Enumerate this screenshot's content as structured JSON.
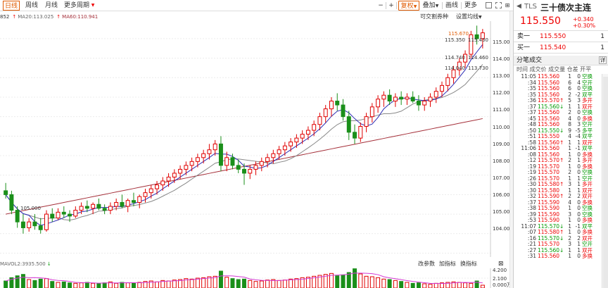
{
  "toolbar": {
    "periods": [
      "日线",
      "周线",
      "月线",
      "更多周期"
    ],
    "active_period": "日线",
    "more_marker": "▼",
    "minus": "−",
    "plus": "+",
    "fuquan": "复权",
    "overlay": "叠加",
    "draw": "画线",
    "more": "更多"
  },
  "legend": {
    "tail": "852",
    "ma20": "MA20:113.025",
    "ma20_arrow": "↑",
    "ma60": "MA60:110.941",
    "ma60_arrow": "↑"
  },
  "chart_tools": {
    "convert_arb": "可交割券种",
    "set_ma": "设置均线"
  },
  "volume_legend": {
    "label": "MAVOL2:3935.500",
    "arrow": "↓",
    "change_params": "改参数",
    "add_indicator": "加指标",
    "switch_indicator": "换指标"
  },
  "price_annotations": {
    "high": "115.670",
    "a": "115.350",
    "b": "115.430",
    "c": "114.740",
    "d": "114.460",
    "e": "114.040",
    "f": "113.730",
    "low": "105.000"
  },
  "price_axis": [
    "115.000",
    "114.000",
    "113.000",
    "112.000",
    "111.000",
    "110.000",
    "109.000",
    "108.000",
    "107.000",
    "106.000",
    "105.000",
    "104.000"
  ],
  "volume_axis": [
    "4.200",
    "2.100",
    "0.000"
  ],
  "volume_unit": "万",
  "instrument": {
    "arrow": "◀",
    "code": "TLS",
    "name": "三十债次主连",
    "price": "115.550",
    "change": "+0.340",
    "change_pct": "+0.30%"
  },
  "orderbook": {
    "sell_label": "卖一",
    "sell_price": "115.550",
    "sell_vol": "1",
    "buy_label": "买一",
    "buy_price": "115.540",
    "buy_vol": "1"
  },
  "fenbi": {
    "title": "分笔成交",
    "detail": "详",
    "headers": "时间    成交价 成交量 仓差 开平"
  },
  "trades": [
    {
      "t": "11:05",
      "p": "115.560",
      "a": "",
      "v": "1",
      "d": "0",
      "tp": "空换",
      "c": "#090"
    },
    {
      "t": ":34",
      "p": "115.560",
      "a": "",
      "v": "6",
      "d": "4",
      "tp": "空开",
      "c": "#090"
    },
    {
      "t": ":35",
      "p": "115.560",
      "a": "",
      "v": "6",
      "d": "0",
      "tp": "空换",
      "c": "#090"
    },
    {
      "t": ":35",
      "p": "115.560",
      "a": "",
      "v": "2",
      "d": "-2",
      "tp": "双平",
      "c": "#090"
    },
    {
      "t": ":36",
      "p": "115.570",
      "a": "↑",
      "v": "5",
      "d": "3",
      "tp": "多开",
      "c": "#e00"
    },
    {
      "t": ":37",
      "p": "115.560",
      "a": "↓",
      "v": "1",
      "d": "1",
      "tp": "双开",
      "c": "#e00"
    },
    {
      "t": ":37",
      "p": "115.560",
      "a": "",
      "v": "2",
      "d": "0",
      "tp": "空换",
      "c": "#090"
    },
    {
      "t": ":45",
      "p": "115.560",
      "a": "",
      "v": "4",
      "d": "0",
      "tp": "多换",
      "c": "#e00"
    },
    {
      "t": ":48",
      "p": "115.560",
      "a": "",
      "v": "8",
      "d": "3",
      "tp": "空开",
      "c": "#090"
    },
    {
      "t": ":50",
      "p": "115.550",
      "a": "↓",
      "v": "9",
      "d": "-5",
      "tp": "多平",
      "c": "#090"
    },
    {
      "t": ":51",
      "p": "115.550",
      "a": "",
      "v": "4",
      "d": "-4",
      "tp": "双平",
      "c": "#090"
    },
    {
      "t": ":58",
      "p": "115.560",
      "a": "↑",
      "v": "1",
      "d": "1",
      "tp": "双开",
      "c": "#e00"
    },
    {
      "t": "11:06",
      "p": "115.560",
      "a": "",
      "v": "1",
      "d": "-1",
      "tp": "双平",
      "c": "#090"
    },
    {
      "t": ":08",
      "p": "115.560",
      "a": "",
      "v": "1",
      "d": "0",
      "tp": "多换",
      "c": "#e00"
    },
    {
      "t": ":12",
      "p": "115.570",
      "a": "↑",
      "v": "2",
      "d": "1",
      "tp": "多开",
      "c": "#e00"
    },
    {
      "t": ":19",
      "p": "115.570",
      "a": "",
      "v": "1",
      "d": "0",
      "tp": "多换",
      "c": "#e00"
    },
    {
      "t": ":19",
      "p": "115.570",
      "a": "",
      "v": "2",
      "d": "0",
      "tp": "空换",
      "c": "#090"
    },
    {
      "t": ":26",
      "p": "115.570",
      "a": "",
      "v": "1",
      "d": "1",
      "tp": "空开",
      "c": "#090"
    },
    {
      "t": ":30",
      "p": "115.580",
      "a": "↑",
      "v": "3",
      "d": "1",
      "tp": "多开",
      "c": "#e00"
    },
    {
      "t": ":30",
      "p": "115.580",
      "a": "",
      "v": "1",
      "d": "1",
      "tp": "双开",
      "c": "#e00"
    },
    {
      "t": ":32",
      "p": "115.590",
      "a": "↑",
      "v": "2",
      "d": "2",
      "tp": "双开",
      "c": "#e00"
    },
    {
      "t": ":37",
      "p": "115.590",
      "a": "",
      "v": "4",
      "d": "0",
      "tp": "多换",
      "c": "#e00"
    },
    {
      "t": ":38",
      "p": "115.590",
      "a": "",
      "v": "1",
      "d": "0",
      "tp": "空换",
      "c": "#090"
    },
    {
      "t": ":39",
      "p": "115.590",
      "a": "",
      "v": "3",
      "d": "0",
      "tp": "空换",
      "c": "#090"
    },
    {
      "t": ":53",
      "p": "115.590",
      "a": "",
      "v": "1",
      "d": "0",
      "tp": "多换",
      "c": "#e00"
    },
    {
      "t": "11:07",
      "p": "115.570",
      "a": "↓",
      "v": "1",
      "d": "-1",
      "tp": "双平",
      "c": "#090"
    },
    {
      "t": ":07",
      "p": "115.580",
      "a": "↑",
      "v": "1",
      "d": "0",
      "tp": "多换",
      "c": "#e00"
    },
    {
      "t": ":16",
      "p": "115.570",
      "a": "↓",
      "v": "2",
      "d": "2",
      "tp": "双开",
      "c": "#e00"
    },
    {
      "t": ":21",
      "p": "115.570",
      "a": "",
      "v": "3",
      "d": "1",
      "tp": "空开",
      "c": "#090"
    },
    {
      "t": ":27",
      "p": "115.560",
      "a": "↓",
      "v": "1",
      "d": "1",
      "tp": "双开",
      "c": "#e00"
    },
    {
      "t": ":31",
      "p": "115.560",
      "a": "",
      "v": "1",
      "d": "0",
      "tp": "多换",
      "c": "#e00"
    }
  ],
  "colors": {
    "up": "#e00000",
    "down": "#1a8f1a",
    "ma5": "#2d2db4",
    "ma10": "#888888",
    "ma60": "#a5303a",
    "vol_ma": "#d43ad4",
    "accent": "#e05a00"
  },
  "chart_data": {
    "type": "candlestick",
    "price_range": [
      103.8,
      115.9
    ],
    "volume_range": [
      0,
      4.2
    ],
    "candles": [
      {
        "o": 107.2,
        "h": 107.6,
        "l": 106.8,
        "c": 107.0,
        "v": 1.5
      },
      {
        "o": 107.0,
        "h": 107.2,
        "l": 106.0,
        "c": 106.2,
        "v": 2.2
      },
      {
        "o": 106.2,
        "h": 106.4,
        "l": 105.3,
        "c": 105.6,
        "v": 2.6
      },
      {
        "o": 105.6,
        "h": 106.0,
        "l": 105.0,
        "c": 105.3,
        "v": 2.9
      },
      {
        "o": 105.3,
        "h": 105.8,
        "l": 105.1,
        "c": 105.6,
        "v": 1.8
      },
      {
        "o": 105.6,
        "h": 106.0,
        "l": 105.2,
        "c": 105.4,
        "v": 1.6
      },
      {
        "o": 105.4,
        "h": 105.8,
        "l": 105.0,
        "c": 105.2,
        "v": 1.9
      },
      {
        "o": 105.2,
        "h": 106.2,
        "l": 105.1,
        "c": 106.0,
        "v": 2.0
      },
      {
        "o": 106.0,
        "h": 106.3,
        "l": 105.6,
        "c": 105.8,
        "v": 1.4
      },
      {
        "o": 105.8,
        "h": 106.3,
        "l": 105.7,
        "c": 106.1,
        "v": 1.2
      },
      {
        "o": 106.1,
        "h": 106.4,
        "l": 105.8,
        "c": 106.0,
        "v": 1.3
      },
      {
        "o": 106.0,
        "h": 106.2,
        "l": 105.6,
        "c": 105.9,
        "v": 1.1
      },
      {
        "o": 105.9,
        "h": 106.4,
        "l": 105.8,
        "c": 106.2,
        "v": 1.0
      },
      {
        "o": 106.2,
        "h": 106.6,
        "l": 106.0,
        "c": 106.4,
        "v": 1.1
      },
      {
        "o": 106.4,
        "h": 106.7,
        "l": 106.1,
        "c": 106.3,
        "v": 1.2
      },
      {
        "o": 106.3,
        "h": 106.6,
        "l": 106.0,
        "c": 106.5,
        "v": 1.0
      },
      {
        "o": 106.5,
        "h": 106.8,
        "l": 106.2,
        "c": 106.3,
        "v": 0.9
      },
      {
        "o": 106.3,
        "h": 106.5,
        "l": 106.0,
        "c": 106.2,
        "v": 1.1
      },
      {
        "o": 106.2,
        "h": 106.6,
        "l": 106.0,
        "c": 106.4,
        "v": 1.3
      },
      {
        "o": 106.4,
        "h": 106.8,
        "l": 106.2,
        "c": 106.6,
        "v": 1.0
      },
      {
        "o": 106.6,
        "h": 107.0,
        "l": 106.3,
        "c": 106.4,
        "v": 1.2
      },
      {
        "o": 106.4,
        "h": 106.8,
        "l": 106.1,
        "c": 106.7,
        "v": 1.1
      },
      {
        "o": 106.7,
        "h": 107.1,
        "l": 106.4,
        "c": 106.6,
        "v": 1.0
      },
      {
        "o": 106.6,
        "h": 107.0,
        "l": 106.3,
        "c": 106.9,
        "v": 1.2
      },
      {
        "o": 106.9,
        "h": 107.3,
        "l": 106.6,
        "c": 107.1,
        "v": 1.4
      },
      {
        "o": 107.1,
        "h": 107.5,
        "l": 106.8,
        "c": 107.3,
        "v": 1.5
      },
      {
        "o": 107.3,
        "h": 107.7,
        "l": 107.0,
        "c": 107.5,
        "v": 1.3
      },
      {
        "o": 107.5,
        "h": 107.9,
        "l": 107.2,
        "c": 107.7,
        "v": 1.6
      },
      {
        "o": 107.7,
        "h": 108.1,
        "l": 107.4,
        "c": 107.9,
        "v": 1.5
      },
      {
        "o": 107.9,
        "h": 108.3,
        "l": 107.6,
        "c": 108.1,
        "v": 1.7
      },
      {
        "o": 108.1,
        "h": 108.5,
        "l": 107.8,
        "c": 108.3,
        "v": 1.8
      },
      {
        "o": 108.3,
        "h": 108.7,
        "l": 108.0,
        "c": 108.5,
        "v": 2.0
      },
      {
        "o": 108.5,
        "h": 108.9,
        "l": 108.2,
        "c": 108.7,
        "v": 1.9
      },
      {
        "o": 108.7,
        "h": 109.1,
        "l": 108.4,
        "c": 108.9,
        "v": 2.1
      },
      {
        "o": 108.9,
        "h": 109.3,
        "l": 108.6,
        "c": 109.1,
        "v": 2.2
      },
      {
        "o": 109.1,
        "h": 109.6,
        "l": 108.8,
        "c": 109.3,
        "v": 2.4
      },
      {
        "o": 109.3,
        "h": 109.8,
        "l": 109.0,
        "c": 109.6,
        "v": 2.5
      },
      {
        "o": 109.6,
        "h": 110.0,
        "l": 108.2,
        "c": 108.5,
        "v": 3.6
      },
      {
        "o": 108.5,
        "h": 109.2,
        "l": 108.2,
        "c": 108.9,
        "v": 2.3
      },
      {
        "o": 108.9,
        "h": 109.1,
        "l": 108.3,
        "c": 108.5,
        "v": 2.0
      },
      {
        "o": 108.5,
        "h": 108.8,
        "l": 108.1,
        "c": 108.3,
        "v": 1.8
      },
      {
        "o": 108.3,
        "h": 108.6,
        "l": 107.5,
        "c": 108.1,
        "v": 1.9
      },
      {
        "o": 108.1,
        "h": 108.5,
        "l": 107.8,
        "c": 108.3,
        "v": 1.6
      },
      {
        "o": 108.3,
        "h": 108.7,
        "l": 108.0,
        "c": 108.5,
        "v": 1.4
      },
      {
        "o": 108.5,
        "h": 108.9,
        "l": 108.2,
        "c": 108.7,
        "v": 1.5
      },
      {
        "o": 108.7,
        "h": 109.1,
        "l": 108.4,
        "c": 108.9,
        "v": 1.7
      },
      {
        "o": 108.9,
        "h": 109.3,
        "l": 108.6,
        "c": 109.1,
        "v": 1.8
      },
      {
        "o": 109.1,
        "h": 109.5,
        "l": 108.8,
        "c": 109.3,
        "v": 1.6
      },
      {
        "o": 109.3,
        "h": 109.7,
        "l": 109.0,
        "c": 109.5,
        "v": 1.7
      },
      {
        "o": 109.5,
        "h": 109.9,
        "l": 109.2,
        "c": 109.7,
        "v": 1.9
      },
      {
        "o": 109.7,
        "h": 110.1,
        "l": 109.4,
        "c": 109.9,
        "v": 2.0
      },
      {
        "o": 109.9,
        "h": 110.3,
        "l": 109.6,
        "c": 110.1,
        "v": 2.2
      },
      {
        "o": 110.1,
        "h": 110.5,
        "l": 109.8,
        "c": 110.3,
        "v": 2.3
      },
      {
        "o": 110.3,
        "h": 110.8,
        "l": 110.0,
        "c": 110.6,
        "v": 2.5
      },
      {
        "o": 110.6,
        "h": 111.2,
        "l": 110.3,
        "c": 111.0,
        "v": 2.7
      },
      {
        "o": 111.0,
        "h": 111.6,
        "l": 110.7,
        "c": 111.4,
        "v": 2.9
      },
      {
        "o": 111.4,
        "h": 112.0,
        "l": 111.0,
        "c": 111.8,
        "v": 3.1
      },
      {
        "o": 111.8,
        "h": 112.2,
        "l": 111.3,
        "c": 111.6,
        "v": 2.6
      },
      {
        "o": 111.6,
        "h": 111.9,
        "l": 110.8,
        "c": 111.0,
        "v": 2.8
      },
      {
        "o": 111.0,
        "h": 111.3,
        "l": 109.8,
        "c": 110.2,
        "v": 3.3
      },
      {
        "o": 110.2,
        "h": 110.6,
        "l": 109.6,
        "c": 109.9,
        "v": 4.1
      },
      {
        "o": 109.9,
        "h": 110.7,
        "l": 109.7,
        "c": 110.5,
        "v": 3.0
      },
      {
        "o": 110.5,
        "h": 111.2,
        "l": 110.2,
        "c": 111.0,
        "v": 2.5
      },
      {
        "o": 111.0,
        "h": 111.7,
        "l": 110.7,
        "c": 111.5,
        "v": 2.4
      },
      {
        "o": 111.5,
        "h": 112.1,
        "l": 111.2,
        "c": 111.9,
        "v": 2.2
      },
      {
        "o": 111.9,
        "h": 112.3,
        "l": 111.5,
        "c": 112.1,
        "v": 1.9
      },
      {
        "o": 112.1,
        "h": 112.4,
        "l": 111.6,
        "c": 111.8,
        "v": 1.8
      },
      {
        "o": 111.8,
        "h": 112.2,
        "l": 111.5,
        "c": 112.0,
        "v": 1.6
      },
      {
        "o": 112.0,
        "h": 112.3,
        "l": 111.6,
        "c": 111.9,
        "v": 1.4
      },
      {
        "o": 111.9,
        "h": 112.2,
        "l": 111.6,
        "c": 112.0,
        "v": 1.2
      },
      {
        "o": 112.0,
        "h": 112.3,
        "l": 111.7,
        "c": 111.8,
        "v": 1.0
      },
      {
        "o": 111.8,
        "h": 112.1,
        "l": 111.3,
        "c": 111.6,
        "v": 1.1
      },
      {
        "o": 111.6,
        "h": 112.0,
        "l": 111.3,
        "c": 111.8,
        "v": 0.9
      },
      {
        "o": 111.8,
        "h": 112.2,
        "l": 111.5,
        "c": 112.0,
        "v": 0.8
      },
      {
        "o": 112.0,
        "h": 112.5,
        "l": 111.7,
        "c": 112.3,
        "v": 1.0
      },
      {
        "o": 112.3,
        "h": 112.8,
        "l": 112.0,
        "c": 112.6,
        "v": 1.1
      },
      {
        "o": 112.6,
        "h": 113.2,
        "l": 112.3,
        "c": 113.0,
        "v": 1.2
      },
      {
        "o": 113.0,
        "h": 113.6,
        "l": 112.7,
        "c": 113.4,
        "v": 1.3
      },
      {
        "o": 113.4,
        "h": 114.0,
        "l": 113.1,
        "c": 113.8,
        "v": 1.2
      },
      {
        "o": 113.8,
        "h": 114.4,
        "l": 113.5,
        "c": 114.2,
        "v": 1.1
      },
      {
        "o": 114.2,
        "h": 115.4,
        "l": 114.0,
        "c": 115.2,
        "v": 1.0
      },
      {
        "o": 115.2,
        "h": 115.67,
        "l": 114.7,
        "c": 115.0,
        "v": 1.5
      },
      {
        "o": 115.0,
        "h": 115.5,
        "l": 114.5,
        "c": 115.3,
        "v": 0.6
      }
    ]
  }
}
